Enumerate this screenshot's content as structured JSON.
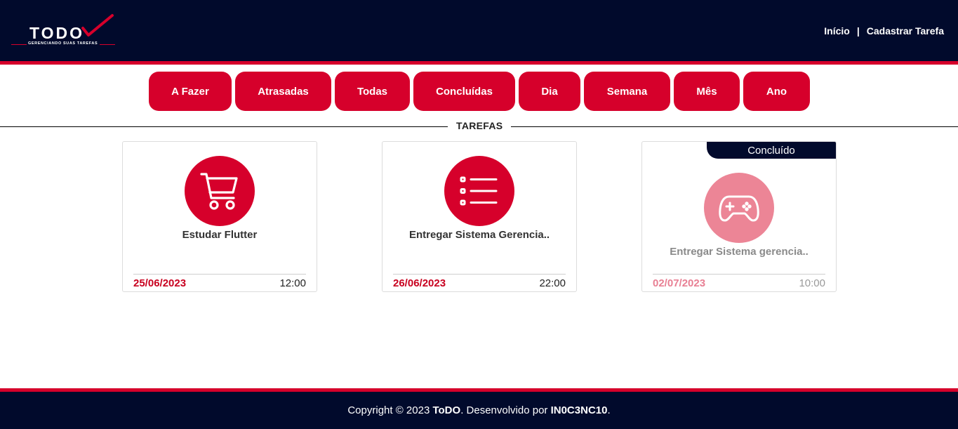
{
  "brand": {
    "logo_text": "TODO",
    "logo_subtitle": "GERENCIANDO SUAS TAREFAS",
    "colors": {
      "navy": "#010a2c",
      "red": "#d6002b"
    }
  },
  "nav": {
    "home": "Início",
    "separator": "|",
    "register": "Cadastrar Tarefa"
  },
  "filters": [
    "A Fazer",
    "Atrasadas",
    "Todas",
    "Concluídas",
    "Dia",
    "Semana",
    "Mês",
    "Ano"
  ],
  "section_title": "TAREFAS",
  "tasks": [
    {
      "icon": "shopping-cart-icon",
      "title": "Estudar Flutter",
      "date": "25/06/2023",
      "time": "12:00",
      "done": false
    },
    {
      "icon": "list-icon",
      "title": "Entregar Sistema Gerencia..",
      "date": "26/06/2023",
      "time": "22:00",
      "done": false
    },
    {
      "icon": "gamepad-icon",
      "title": "Entregar Sistema gerencia..",
      "date": "02/07/2023",
      "time": "10:00",
      "done": true,
      "badge": "Concluído"
    }
  ],
  "footer": {
    "prefix": "Copyright © 2023 ",
    "brand": "ToDO",
    "middle": ". Desenvolvido por ",
    "author": "IN0C3NC10",
    "suffix": "."
  }
}
